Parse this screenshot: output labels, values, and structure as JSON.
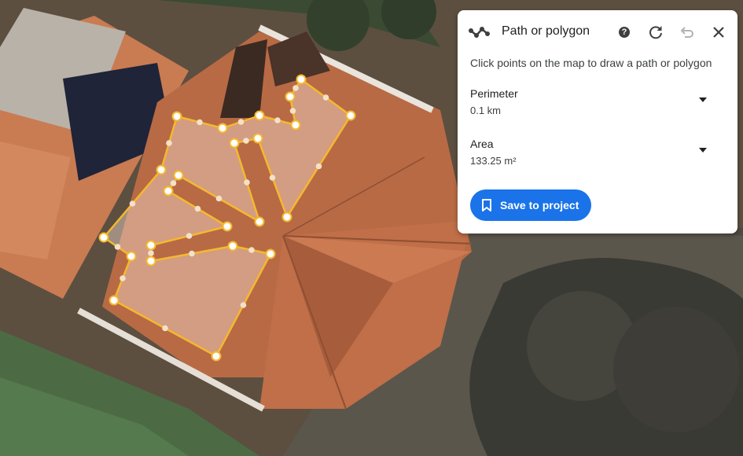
{
  "panel": {
    "title": "Path or polygon",
    "instruction": "Click points on the map to draw a path or polygon",
    "perimeter": {
      "label": "Perimeter",
      "value": "0.1 km"
    },
    "area": {
      "label": "Area",
      "value": "133.25 m²"
    },
    "save_label": "Save to project"
  },
  "colors": {
    "accent": "#1a73e8",
    "polygon_stroke": "#f5b82e",
    "polygon_fill": "#f2dccd"
  }
}
